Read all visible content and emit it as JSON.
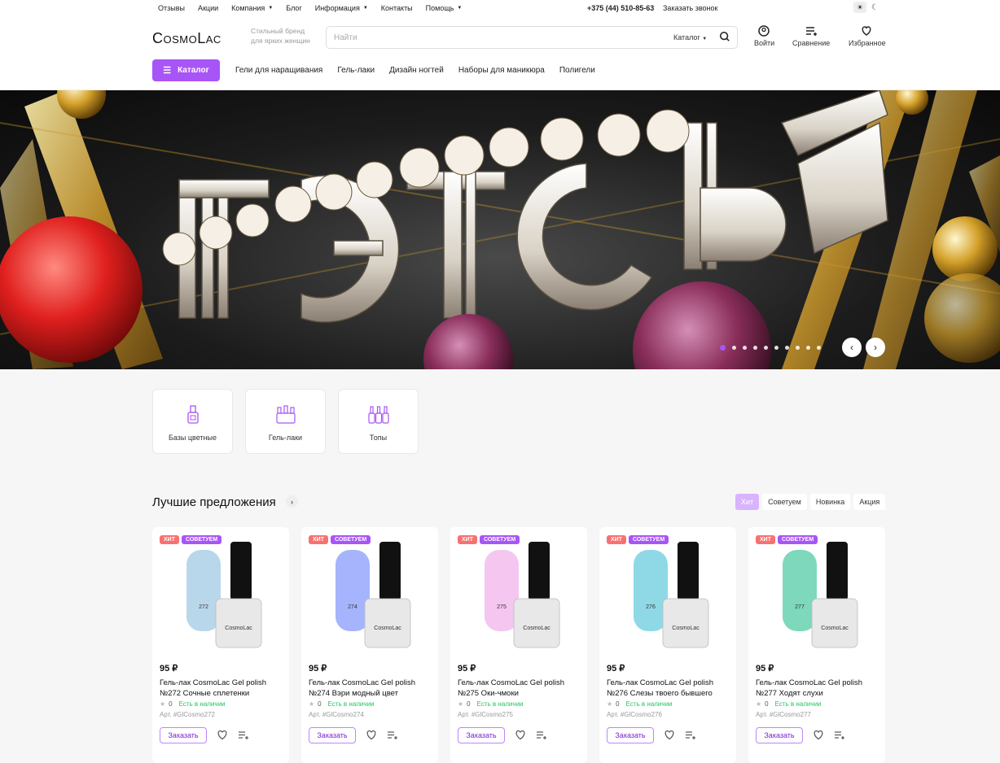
{
  "topbar": {
    "nav": [
      {
        "label": "Отзывы",
        "dropdown": false
      },
      {
        "label": "Акции",
        "dropdown": false
      },
      {
        "label": "Компания",
        "dropdown": true
      },
      {
        "label": "Блог",
        "dropdown": false
      },
      {
        "label": "Информация",
        "dropdown": true
      },
      {
        "label": "Контакты",
        "dropdown": false
      },
      {
        "label": "Помощь",
        "dropdown": true
      }
    ],
    "phone": "+375 (44) 510-85-63",
    "callback": "Заказать звонок"
  },
  "header": {
    "logo": "CosmoLac",
    "tagline": "Стильный бренд для ярких женщин",
    "search_placeholder": "Найти",
    "search_scope": "Каталог",
    "login": "Войти",
    "compare": "Сравнение",
    "favorites": "Избранное"
  },
  "menu": {
    "catalog_button": "Каталог",
    "items": [
      "Гели для наращивания",
      "Гель-лаки",
      "Дизайн ногтей",
      "Наборы для маникюра",
      "Полигели"
    ]
  },
  "hero": {
    "alt": "вечеринка Гэтсби",
    "slides": 10,
    "active_slide": 1
  },
  "categories": [
    {
      "label": "Базы цветные",
      "icon": "nail-polish-bottle-icon"
    },
    {
      "label": "Гель-лаки",
      "icon": "polish-set-icon"
    },
    {
      "label": "Топы",
      "icon": "top-coat-icon"
    }
  ],
  "section": {
    "title": "Лучшие предложения",
    "filters": [
      "Хит",
      "Советуем",
      "Новинка",
      "Акция"
    ],
    "active_filter": "Хит"
  },
  "products": [
    {
      "badge1": "ХИТ",
      "badge2": "СОВЕТУЕМ",
      "price": "95 ₽",
      "name": "Гель-лак CosmoLac Gel polish №272 Сочные сплетенки",
      "rating": "0",
      "stock": "Есть в наличии",
      "art": "Арт. #GlCosmo272",
      "order": "Заказать",
      "num": "272",
      "color": "#b9d7ea"
    },
    {
      "badge1": "ХИТ",
      "badge2": "СОВЕТУЕМ",
      "price": "95 ₽",
      "name": "Гель-лак CosmoLac Gel polish №274 Вэри модный цвет",
      "rating": "0",
      "stock": "Есть в наличии",
      "art": "Арт. #GlCosmo274",
      "order": "Заказать",
      "num": "274",
      "color": "#a5b4fc"
    },
    {
      "badge1": "ХИТ",
      "badge2": "СОВЕТУЕМ",
      "price": "95 ₽",
      "name": "Гель-лак CosmoLac Gel polish №275 Оки-чмоки",
      "rating": "0",
      "stock": "Есть в наличии",
      "art": "Арт. #GlCosmo275",
      "order": "Заказать",
      "num": "275",
      "color": "#f5c6f0"
    },
    {
      "badge1": "ХИТ",
      "badge2": "СОВЕТУЕМ",
      "price": "95 ₽",
      "name": "Гель-лак CosmoLac Gel polish №276 Слезы твоего бывшего",
      "rating": "0",
      "stock": "Есть в наличии",
      "art": "Арт. #GlCosmo276",
      "order": "Заказать",
      "num": "276",
      "color": "#8fd8e6"
    },
    {
      "badge1": "ХИТ",
      "badge2": "СОВЕТУЕМ",
      "price": "95 ₽",
      "name": "Гель-лак CosmoLac Gel polish №277 Ходят слухи",
      "rating": "0",
      "stock": "Есть в наличии",
      "art": "Арт. #GlCosmo277",
      "order": "Заказать",
      "num": "277",
      "color": "#7dd8bc"
    }
  ]
}
